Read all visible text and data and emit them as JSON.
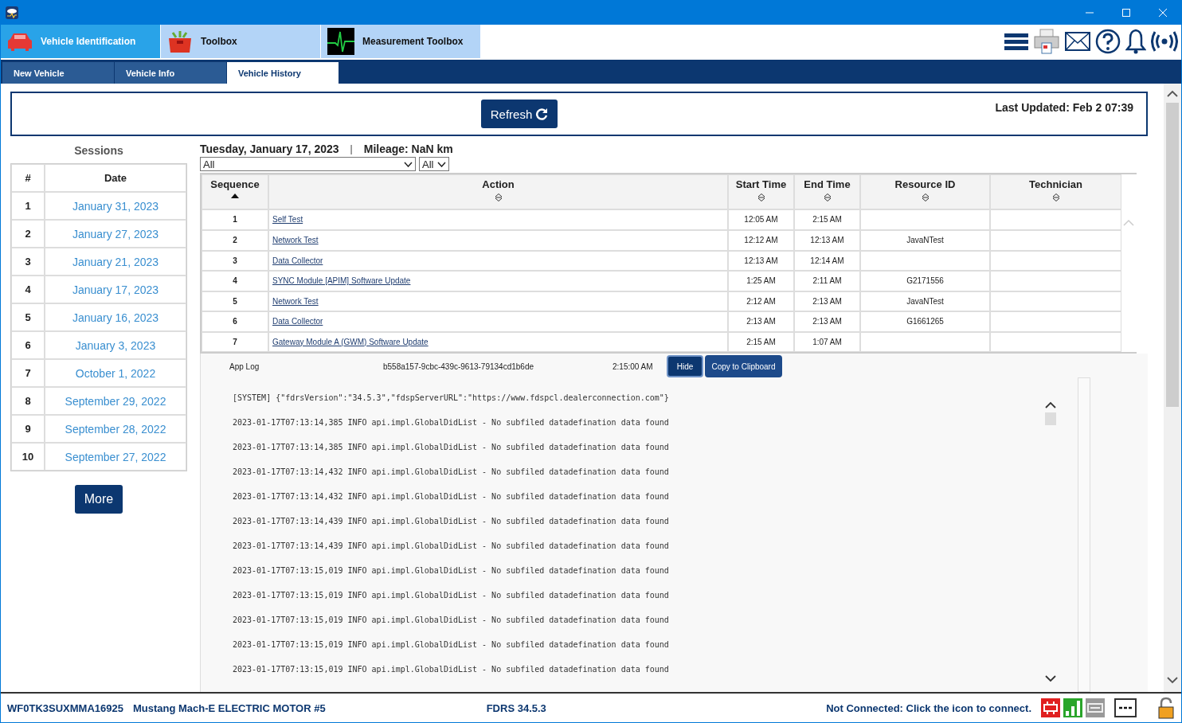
{
  "module_tabs": [
    {
      "label": "Vehicle Identification",
      "kind": "car",
      "selected": true
    },
    {
      "label": "Toolbox",
      "kind": "toolbox",
      "selected": false
    },
    {
      "label": "Measurement Toolbox",
      "kind": "scope",
      "selected": false
    }
  ],
  "sub_tabs": [
    {
      "label": "New Vehicle",
      "selected": false
    },
    {
      "label": "Vehicle Info",
      "selected": false
    },
    {
      "label": "Vehicle History",
      "selected": true
    }
  ],
  "refresh_button": "Refresh",
  "last_updated": "Last Updated: Feb 2 07:39",
  "sessions": {
    "title": "Sessions",
    "columns": [
      "#",
      "Date"
    ],
    "rows": [
      {
        "number": "1",
        "date": "January 31, 2023"
      },
      {
        "number": "2",
        "date": "January 27, 2023"
      },
      {
        "number": "3",
        "date": "January 21, 2023"
      },
      {
        "number": "4",
        "date": "January 17, 2023"
      },
      {
        "number": "5",
        "date": "January 16, 2023"
      },
      {
        "number": "6",
        "date": "January 3, 2023"
      },
      {
        "number": "7",
        "date": "October 1, 2022"
      },
      {
        "number": "8",
        "date": "September 29, 2022"
      },
      {
        "number": "9",
        "date": "September 28, 2022"
      },
      {
        "number": "10",
        "date": "September 27, 2022"
      }
    ],
    "more_button": "More"
  },
  "session_date": "Tuesday, January 17, 2023",
  "separator": "|",
  "mileage": "Mileage: NaN km",
  "filters": [
    "All",
    "All"
  ],
  "table": {
    "columns": [
      {
        "label": "Sequence",
        "sorted": true
      },
      {
        "label": "Action",
        "sorted": false
      },
      {
        "label": "Start Time",
        "sorted": false
      },
      {
        "label": "End Time",
        "sorted": false
      },
      {
        "label": "Resource ID",
        "sorted": false
      },
      {
        "label": "Technician",
        "sorted": false
      }
    ],
    "rows": [
      {
        "sequence": "1",
        "action": "Self Test",
        "start": "12:05 AM",
        "end": "2:15 AM"
      },
      {
        "sequence": "2",
        "action": "Network Test",
        "start": "12:12 AM",
        "end": "12:13 AM",
        "resource": "JavaNTest"
      },
      {
        "sequence": "3",
        "action": "Data Collector",
        "start": "12:13 AM",
        "end": "12:14 AM"
      },
      {
        "sequence": "4",
        "action": "SYNC Module [APIM] Software Update",
        "start": "1:25 AM",
        "end": "2:11 AM",
        "resource": "G2171556"
      },
      {
        "sequence": "5",
        "action": "Network Test",
        "start": "2:12 AM",
        "end": "2:13 AM",
        "resource": "JavaNTest"
      },
      {
        "sequence": "6",
        "action": "Data Collector",
        "start": "2:13 AM",
        "end": "2:13 AM",
        "resource": "G1661265"
      },
      {
        "sequence": "7",
        "action": "Gateway Module A (GWM) Software Update",
        "start": "2:15 AM",
        "end": "1:07 AM"
      }
    ]
  },
  "app_log": {
    "label": "App Log",
    "id": "b558a157-9cbc-439c-9613-79134cd1b6de",
    "time": "2:15:00 AM",
    "hide_button": "Hide",
    "copy_button": "Copy to Clipboard",
    "lines": [
      "[SYSTEM] {\"fdrsVersion\":\"34.5.3\",\"fdspServerURL\":\"https://www.fdspcl.dealerconnection.com\"}",
      "2023-01-17T07:13:14,385 INFO api.impl.GlobalDidList - No subfiled datadefination data found",
      "2023-01-17T07:13:14,385 INFO api.impl.GlobalDidList - No subfiled datadefination data found",
      "2023-01-17T07:13:14,432 INFO api.impl.GlobalDidList - No subfiled datadefination data found",
      "2023-01-17T07:13:14,432 INFO api.impl.GlobalDidList - No subfiled datadefination data found",
      "2023-01-17T07:13:14,439 INFO api.impl.GlobalDidList - No subfiled datadefination data found",
      "2023-01-17T07:13:14,439 INFO api.impl.GlobalDidList - No subfiled datadefination data found",
      "2023-01-17T07:13:15,019 INFO api.impl.GlobalDidList - No subfiled datadefination data found",
      "2023-01-17T07:13:15,019 INFO api.impl.GlobalDidList - No subfiled datadefination data found",
      "2023-01-17T07:13:15,019 INFO api.impl.GlobalDidList - No subfiled datadefination data found",
      "2023-01-17T07:13:15,019 INFO api.impl.GlobalDidList - No subfiled datadefination data found",
      "2023-01-17T07:13:15,019 INFO api.impl.GlobalDidList - No subfiled datadefination data found"
    ]
  },
  "status_bar": {
    "vin": "WF0TK3SUXMMA16925",
    "vehicle": "Mustang Mach-E ELECTRIC MOTOR #5",
    "version": "FDRS 34.5.3",
    "connection": "Not Connected: Click the icon to connect."
  }
}
